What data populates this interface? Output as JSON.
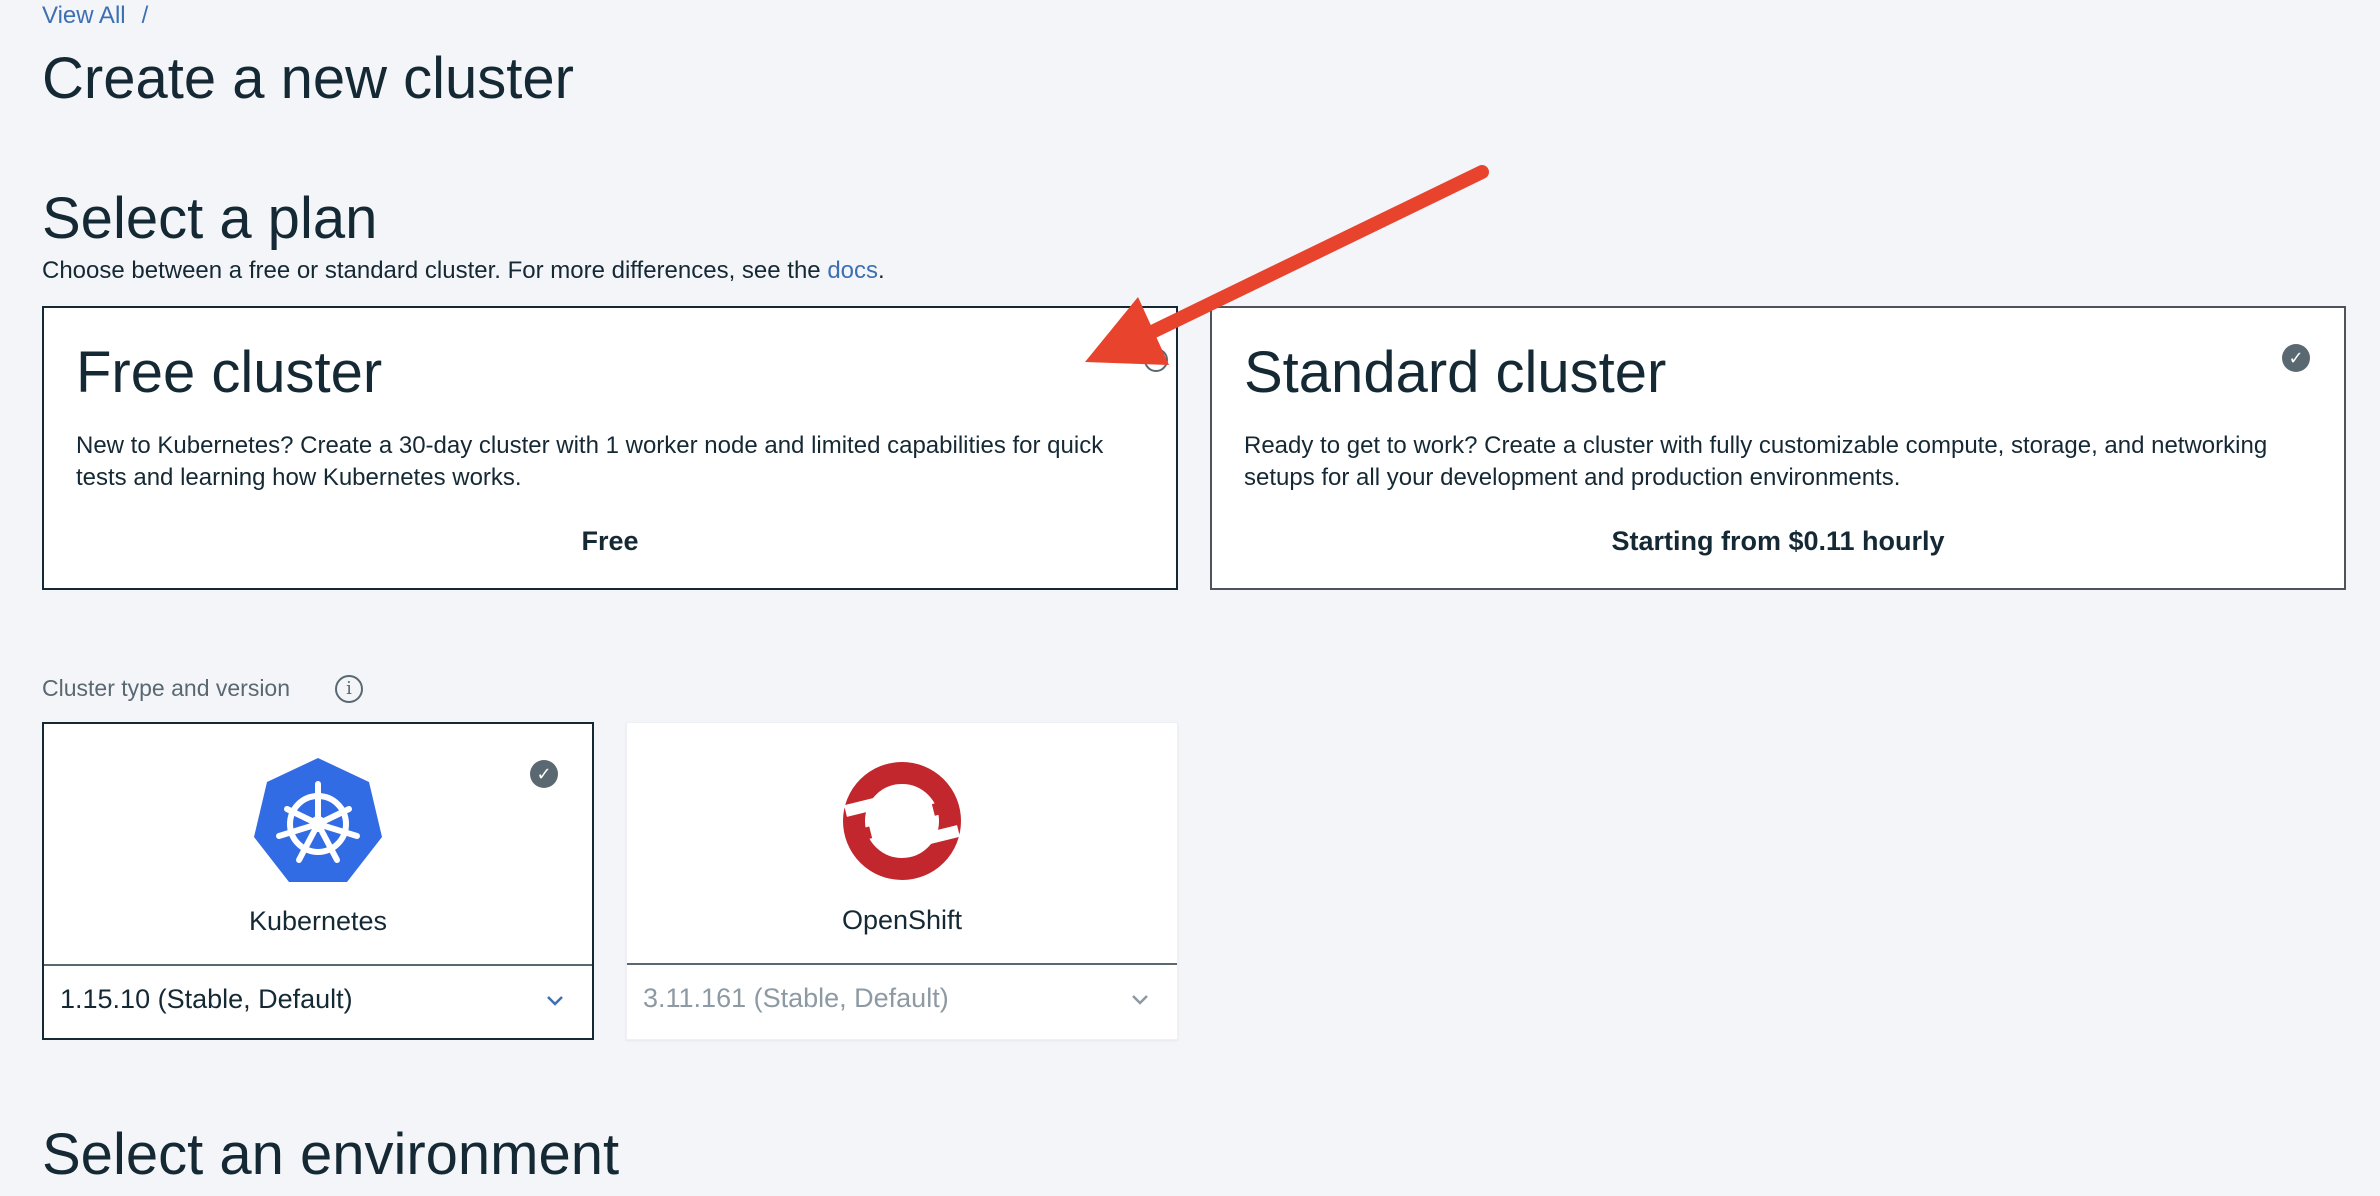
{
  "breadcrumb": {
    "link_label": "View All",
    "separator": "/"
  },
  "page": {
    "title": "Create a new cluster"
  },
  "plan_section": {
    "title": "Select a plan",
    "desc_prefix": "Choose between a free or standard cluster. For more differences, see the ",
    "desc_link": "docs",
    "desc_suffix": ".",
    "plans": [
      {
        "name": "Free cluster",
        "description": "New to Kubernetes? Create a 30-day cluster with 1 worker node and limited capabilities for quick tests and learning how Kubernetes works.",
        "price": "Free",
        "selected": false
      },
      {
        "name": "Standard cluster",
        "description": "Ready to get to work? Create a cluster with fully customizable compute, storage, and networking setups for all your development and production environments.",
        "price": "Starting from $0.11 hourly",
        "selected": true
      }
    ]
  },
  "cluster_type": {
    "label": "Cluster type and version",
    "info_icon": "info-icon",
    "options": [
      {
        "name": "Kubernetes",
        "version": "1.15.10 (Stable, Default)",
        "selected": true,
        "icon": "kubernetes-logo-icon"
      },
      {
        "name": "OpenShift",
        "version": "3.11.161 (Stable, Default)",
        "selected": false,
        "icon": "openshift-logo-icon"
      }
    ]
  },
  "environment_section": {
    "title": "Select an environment"
  },
  "colors": {
    "link": "#3d70b2",
    "text": "#152935",
    "annotation_arrow": "#e8432d",
    "kubernetes_blue": "#326ce5",
    "openshift_red": "#c1272d"
  }
}
